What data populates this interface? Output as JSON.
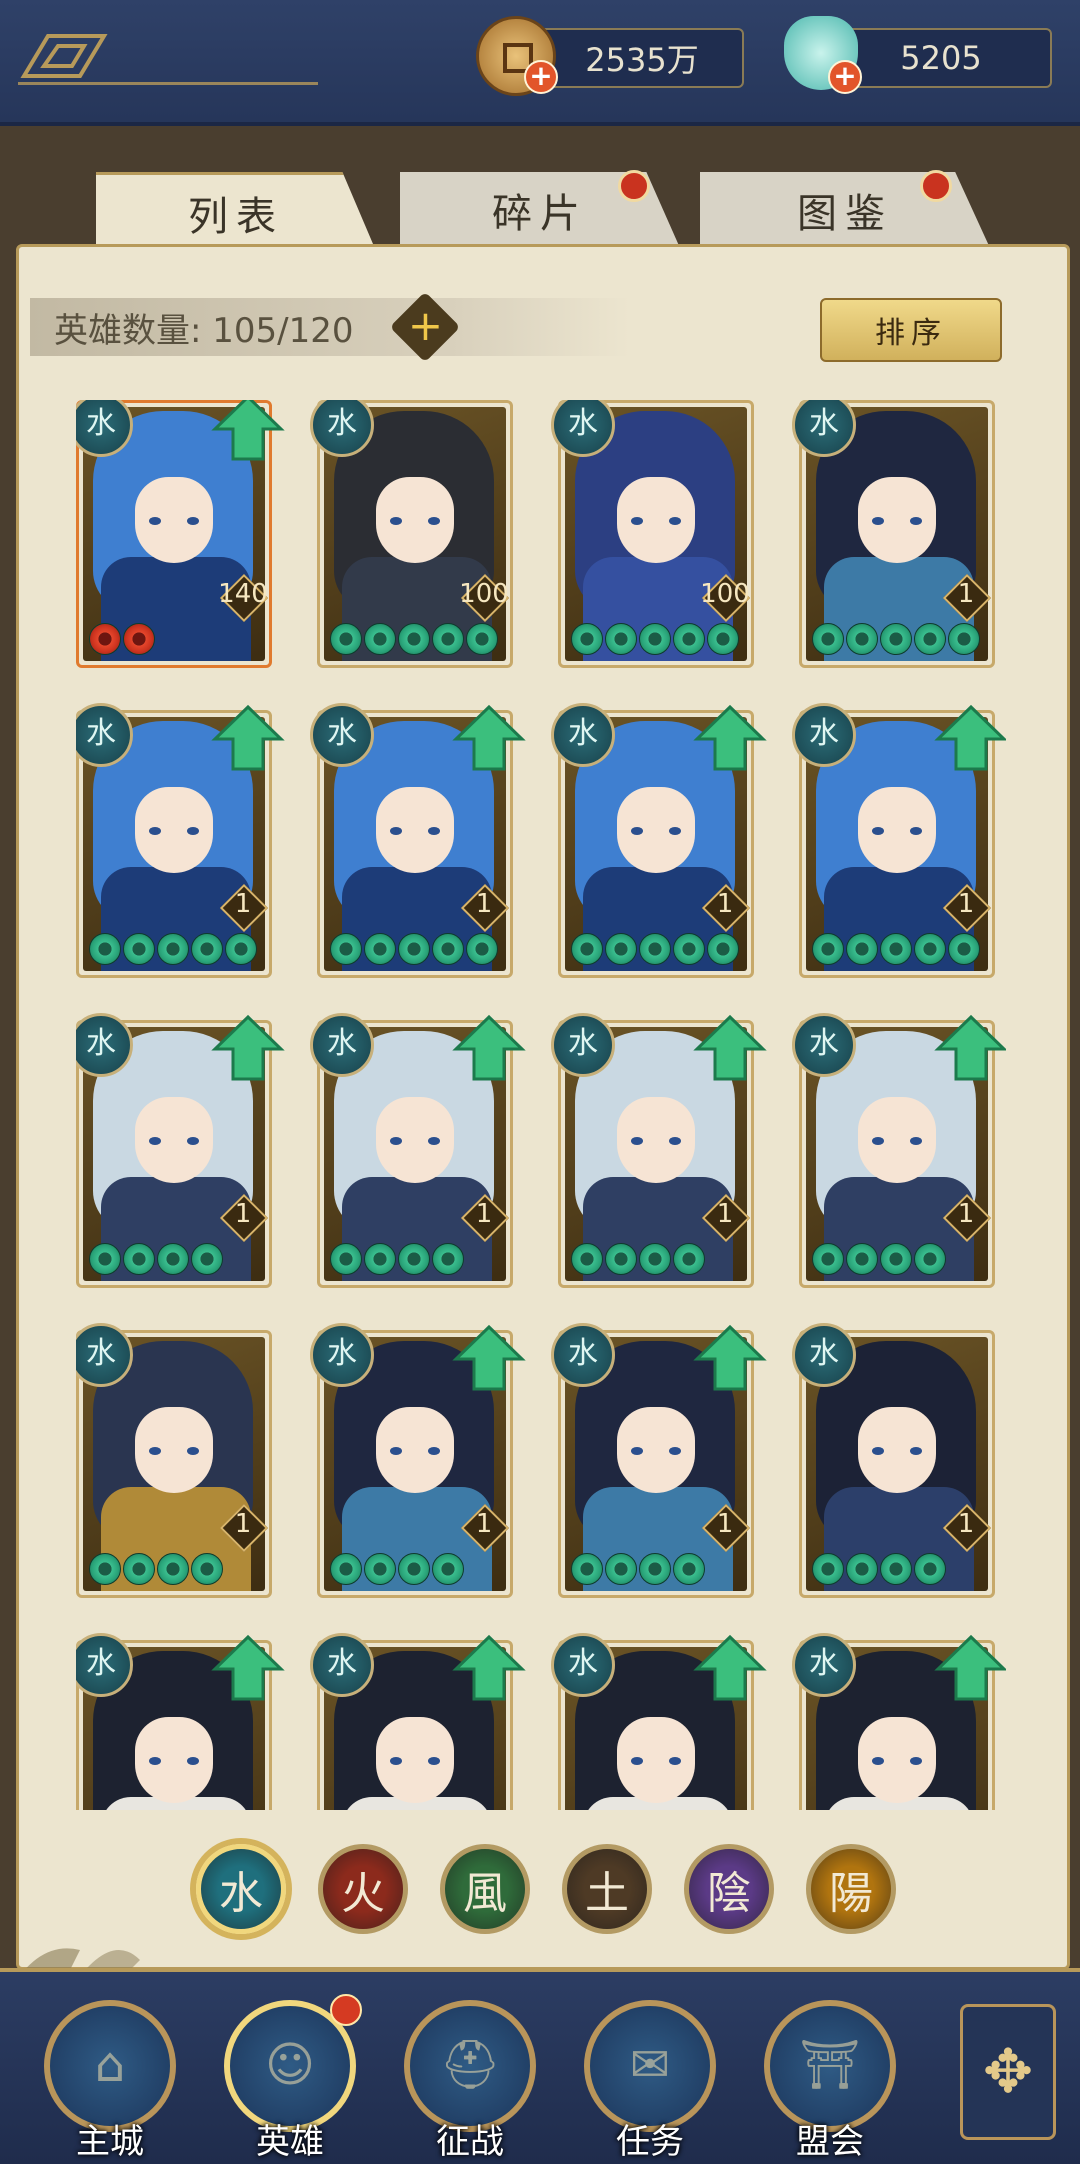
{
  "currencies": [
    {
      "icon": "copper-coin-icon",
      "amount": "2535万"
    },
    {
      "icon": "jade-pouch-icon",
      "amount": "5205"
    }
  ],
  "tabs": [
    {
      "label": "列表",
      "active": true,
      "notice": false
    },
    {
      "label": "碎片",
      "active": false,
      "notice": true
    },
    {
      "label": "图鉴",
      "active": false,
      "notice": true
    }
  ],
  "hero_count": {
    "label": "英雄数量: 105/120",
    "plus": "+"
  },
  "sort_label": "排序",
  "heroes": [
    {
      "style": "blue-hair-girl",
      "level": "140",
      "stars": 2,
      "star_color": "red",
      "upgradable": true,
      "rare": true
    },
    {
      "style": "dark-armor-man",
      "level": "100",
      "stars": 5,
      "star_color": "green",
      "upgradable": false,
      "rare": false
    },
    {
      "style": "opera-lady",
      "level": "100",
      "stars": 5,
      "star_color": "green",
      "upgradable": false,
      "rare": false
    },
    {
      "style": "flower-girl",
      "level": "1",
      "stars": 5,
      "star_color": "green",
      "upgradable": false,
      "rare": false
    },
    {
      "style": "blue-hair-girl",
      "level": "1",
      "stars": 5,
      "star_color": "green",
      "upgradable": true,
      "rare": false
    },
    {
      "style": "blue-hair-girl",
      "level": "1",
      "stars": 5,
      "star_color": "green",
      "upgradable": true,
      "rare": false
    },
    {
      "style": "blue-hair-girl",
      "level": "1",
      "stars": 5,
      "star_color": "green",
      "upgradable": true,
      "rare": false
    },
    {
      "style": "blue-hair-girl",
      "level": "1",
      "stars": 5,
      "star_color": "green",
      "upgradable": true,
      "rare": false
    },
    {
      "style": "silver-hair-man",
      "level": "1",
      "stars": 4,
      "star_color": "green",
      "upgradable": true,
      "rare": false
    },
    {
      "style": "silver-hair-man",
      "level": "1",
      "stars": 4,
      "star_color": "green",
      "upgradable": true,
      "rare": false
    },
    {
      "style": "silver-hair-man",
      "level": "1",
      "stars": 4,
      "star_color": "green",
      "upgradable": true,
      "rare": false
    },
    {
      "style": "silver-hair-man",
      "level": "1",
      "stars": 4,
      "star_color": "green",
      "upgradable": true,
      "rare": false
    },
    {
      "style": "gold-armor-general",
      "level": "1",
      "stars": 4,
      "star_color": "green",
      "upgradable": false,
      "rare": false
    },
    {
      "style": "flower-girl",
      "level": "1",
      "stars": 4,
      "star_color": "green",
      "upgradable": true,
      "rare": false
    },
    {
      "style": "flower-girl",
      "level": "1",
      "stars": 4,
      "star_color": "green",
      "upgradable": true,
      "rare": false
    },
    {
      "style": "masked-hat-warrior",
      "level": "1",
      "stars": 4,
      "star_color": "green",
      "upgradable": false,
      "rare": false
    },
    {
      "style": "black-hair-scholar",
      "level": "",
      "stars": 0,
      "star_color": "green",
      "upgradable": true,
      "rare": false
    },
    {
      "style": "black-hair-scholar",
      "level": "",
      "stars": 0,
      "star_color": "green",
      "upgradable": true,
      "rare": false
    },
    {
      "style": "black-hair-scholar",
      "level": "",
      "stars": 0,
      "star_color": "green",
      "upgradable": true,
      "rare": false
    },
    {
      "style": "black-hair-scholar",
      "level": "",
      "stars": 0,
      "star_color": "green",
      "upgradable": true,
      "rare": false
    }
  ],
  "hero_element_glyph": "水",
  "elements": [
    {
      "glyph": "水",
      "name": "water",
      "color": "#1f6f7d",
      "active": true
    },
    {
      "glyph": "火",
      "name": "fire",
      "color": "#8c2a1c",
      "active": false
    },
    {
      "glyph": "風",
      "name": "wind",
      "color": "#2f6b3a",
      "active": false
    },
    {
      "glyph": "土",
      "name": "earth",
      "color": "#4e3a25",
      "active": false
    },
    {
      "glyph": "陰",
      "name": "yin",
      "color": "#5b3a86",
      "active": false
    },
    {
      "glyph": "陽",
      "name": "yang",
      "color": "#b0740f",
      "active": false
    }
  ],
  "nav": [
    {
      "label": "主城",
      "icon": "palace-icon",
      "active": false
    },
    {
      "label": "英雄",
      "icon": "hero-avatar-icon",
      "active": true,
      "notice": true
    },
    {
      "label": "征战",
      "icon": "helmet-icon",
      "active": false
    },
    {
      "label": "任务",
      "icon": "scroll-icon",
      "active": false
    },
    {
      "label": "盟会",
      "icon": "pavilion-icon",
      "active": false
    }
  ],
  "more_icon": "lattice-menu-icon",
  "colors": {
    "upgrade_arrow": "#3bbf7d",
    "gold_border": "#c7a96a",
    "navy": "#26365a"
  }
}
